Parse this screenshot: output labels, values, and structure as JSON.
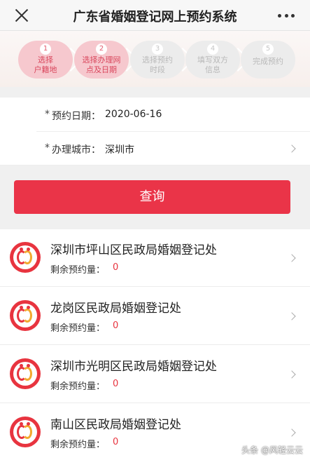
{
  "header": {
    "title": "广东省婚姻登记网上预约系统"
  },
  "steps": [
    {
      "num": "1",
      "line1": "选择",
      "line2": "户籍地",
      "state": "done"
    },
    {
      "num": "2",
      "line1": "选择办理网",
      "line2": "点及日期",
      "state": "done"
    },
    {
      "num": "3",
      "line1": "选择预约",
      "line2": "时段",
      "state": "todo"
    },
    {
      "num": "4",
      "line1": "填写双方",
      "line2": "信息",
      "state": "todo"
    },
    {
      "num": "5",
      "line1": "完成预约",
      "line2": "",
      "state": "todo"
    }
  ],
  "form": {
    "required_mark": "*",
    "date_label": "预约日期：",
    "date_value": "2020-06-16",
    "city_label": "办理城市：",
    "city_value": "深圳市"
  },
  "query_button": "查询",
  "offices": [
    {
      "name": "深圳市坪山区民政局婚姻登记处",
      "quota_label": "剩余预约量：",
      "quota": "0"
    },
    {
      "name": "龙岗区民政局婚姻登记处",
      "quota_label": "剩余预约量：",
      "quota": "0"
    },
    {
      "name": "深圳市光明区民政局婚姻登记处",
      "quota_label": "剩余预约量：",
      "quota": "0"
    },
    {
      "name": "南山区民政局婚姻登记处",
      "quota_label": "剩余预约量：",
      "quota": "0"
    }
  ],
  "watermark": "头条 @风轻云云",
  "colors": {
    "accent": "#ea3448",
    "step_done_bg": "#f6c8ce",
    "step_done_text": "#d9465c",
    "step_todo_bg": "#ececec",
    "quota_value": "#e8343f"
  },
  "icons": {
    "close": "close-icon",
    "more": "more-dots-icon",
    "chevron": "chevron-right-icon",
    "office_logo": "marriage-registry-logo-icon"
  }
}
